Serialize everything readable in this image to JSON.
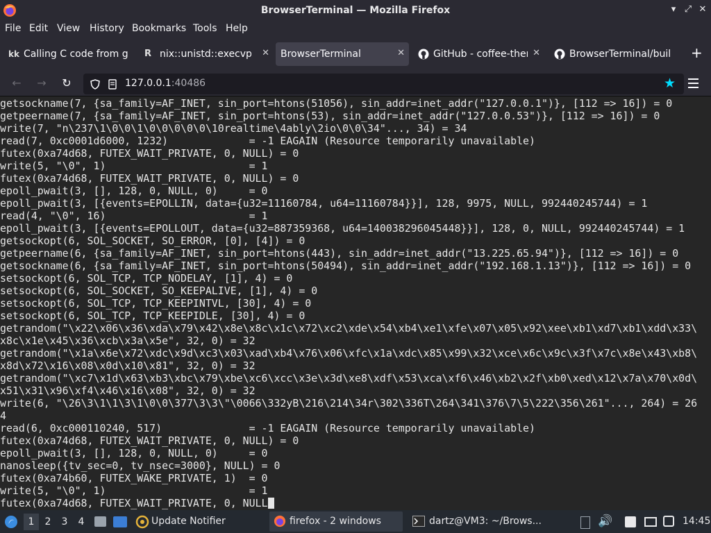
{
  "window": {
    "title": "BrowserTerminal — Mozilla Firefox"
  },
  "menu": [
    "File",
    "Edit",
    "View",
    "History",
    "Bookmarks",
    "Tools",
    "Help"
  ],
  "tabs": [
    {
      "label": "Calling C code from g",
      "icon": "kk-favicon-icon",
      "icon_text": "kk"
    },
    {
      "label": "nix::unistd::execvpe",
      "icon": "rust-favicon-icon",
      "icon_text": "R"
    },
    {
      "label": "BrowserTerminal",
      "icon": "",
      "icon_text": "",
      "active": true
    },
    {
      "label": "GitHub - coffee-them",
      "icon": "github-icon",
      "icon_text": ""
    },
    {
      "label": "BrowserTerminal/buil",
      "icon": "github-icon",
      "icon_text": ""
    }
  ],
  "address": {
    "host": "127.0.0.1",
    "port": ":40486"
  },
  "terminal": {
    "lines": [
      "getsockname(7, {sa_family=AF_INET, sin_port=htons(51056), sin_addr=inet_addr(\"127.0.0.1\")}, [112 => 16]) = 0",
      "getpeername(7, {sa_family=AF_INET, sin_port=htons(53), sin_addr=inet_addr(\"127.0.0.53\")}, [112 => 16]) = 0",
      "write(7, \"n\\237\\1\\0\\0\\1\\0\\0\\0\\0\\0\\10realtime\\4ably\\2io\\0\\0\\34\"..., 34) = 34",
      "read(7, 0xc0001d6000, 1232)             = -1 EAGAIN (Resource temporarily unavailable)",
      "futex(0xa74d68, FUTEX_WAIT_PRIVATE, 0, NULL) = 0",
      "write(5, \"\\0\", 1)                       = 1",
      "futex(0xa74d68, FUTEX_WAIT_PRIVATE, 0, NULL) = 0",
      "epoll_pwait(3, [], 128, 0, NULL, 0)     = 0",
      "epoll_pwait(3, [{events=EPOLLIN, data={u32=11160784, u64=11160784}}], 128, 9975, NULL, 992440245744) = 1",
      "read(4, \"\\0\", 16)                       = 1",
      "epoll_pwait(3, [{events=EPOLLOUT, data={u32=887359368, u64=140038296045448}}], 128, 0, NULL, 992440245744) = 1",
      "getsockopt(6, SOL_SOCKET, SO_ERROR, [0], [4]) = 0",
      "getpeername(6, {sa_family=AF_INET, sin_port=htons(443), sin_addr=inet_addr(\"13.225.65.94\")}, [112 => 16]) = 0",
      "getsockname(6, {sa_family=AF_INET, sin_port=htons(50494), sin_addr=inet_addr(\"192.168.1.13\")}, [112 => 16]) = 0",
      "setsockopt(6, SOL_TCP, TCP_NODELAY, [1], 4) = 0",
      "setsockopt(6, SOL_SOCKET, SO_KEEPALIVE, [1], 4) = 0",
      "setsockopt(6, SOL_TCP, TCP_KEEPINTVL, [30], 4) = 0",
      "setsockopt(6, SOL_TCP, TCP_KEEPIDLE, [30], 4) = 0",
      "getrandom(\"\\x22\\x06\\x36\\xda\\x79\\x42\\x8e\\x8c\\x1c\\x72\\xc2\\xde\\x54\\xb4\\xe1\\xfe\\x07\\x05\\x92\\xee\\xb1\\xd7\\xb1\\xdd\\x33\\",
      "x8c\\x1e\\x45\\x36\\xcb\\x3a\\x5e\", 32, 0) = 32",
      "getrandom(\"\\x1a\\x6e\\x72\\xdc\\x9d\\xc3\\x03\\xad\\xb4\\x76\\x06\\xfc\\x1a\\xdc\\x85\\x99\\x32\\xce\\x6c\\x9c\\x3f\\x7c\\x8e\\x43\\xb8\\",
      "x8d\\x72\\x16\\x08\\x0d\\x10\\x81\", 32, 0) = 32",
      "getrandom(\"\\xc7\\x1d\\x63\\xb3\\xbc\\x79\\xbe\\xc6\\xcc\\x3e\\x3d\\xe8\\xdf\\x53\\xca\\xf6\\x46\\xb2\\x2f\\xb0\\xed\\x12\\x7a\\x70\\x0d\\",
      "x51\\x31\\x96\\xf4\\x46\\x16\\x08\", 32, 0) = 32",
      "write(6, \"\\26\\3\\1\\1\\3\\1\\0\\0\\377\\3\\3\\\"\\0066\\332yB\\216\\214\\34r\\302\\336T\\264\\341\\376\\7\\5\\222\\356\\261\"..., 264) = 26",
      "4",
      "read(6, 0xc000110240, 517)              = -1 EAGAIN (Resource temporarily unavailable)",
      "futex(0xa74d68, FUTEX_WAIT_PRIVATE, 0, NULL) = 0",
      "epoll_pwait(3, [], 128, 0, NULL, 0)     = 0",
      "nanosleep({tv_sec=0, tv_nsec=3000}, NULL) = 0",
      "futex(0xa74b60, FUTEX_WAKE_PRIVATE, 1)  = 0",
      "write(5, \"\\0\", 1)                       = 1",
      "futex(0xa74d68, FUTEX_WAIT_PRIVATE, 0, NULL"
    ]
  },
  "taskbar": {
    "workspaces": [
      "1",
      "2",
      "3",
      "4"
    ],
    "update_notifier": "Update Notifier",
    "firefox_task": "firefox - 2 windows",
    "terminal_task": "dartz@VM3: ~/Brows...",
    "clock": "14:45"
  },
  "colors": {
    "terminal_bg": "#262626",
    "chrome_bg": "#2b2a33",
    "accent_star": "#00ddff"
  }
}
